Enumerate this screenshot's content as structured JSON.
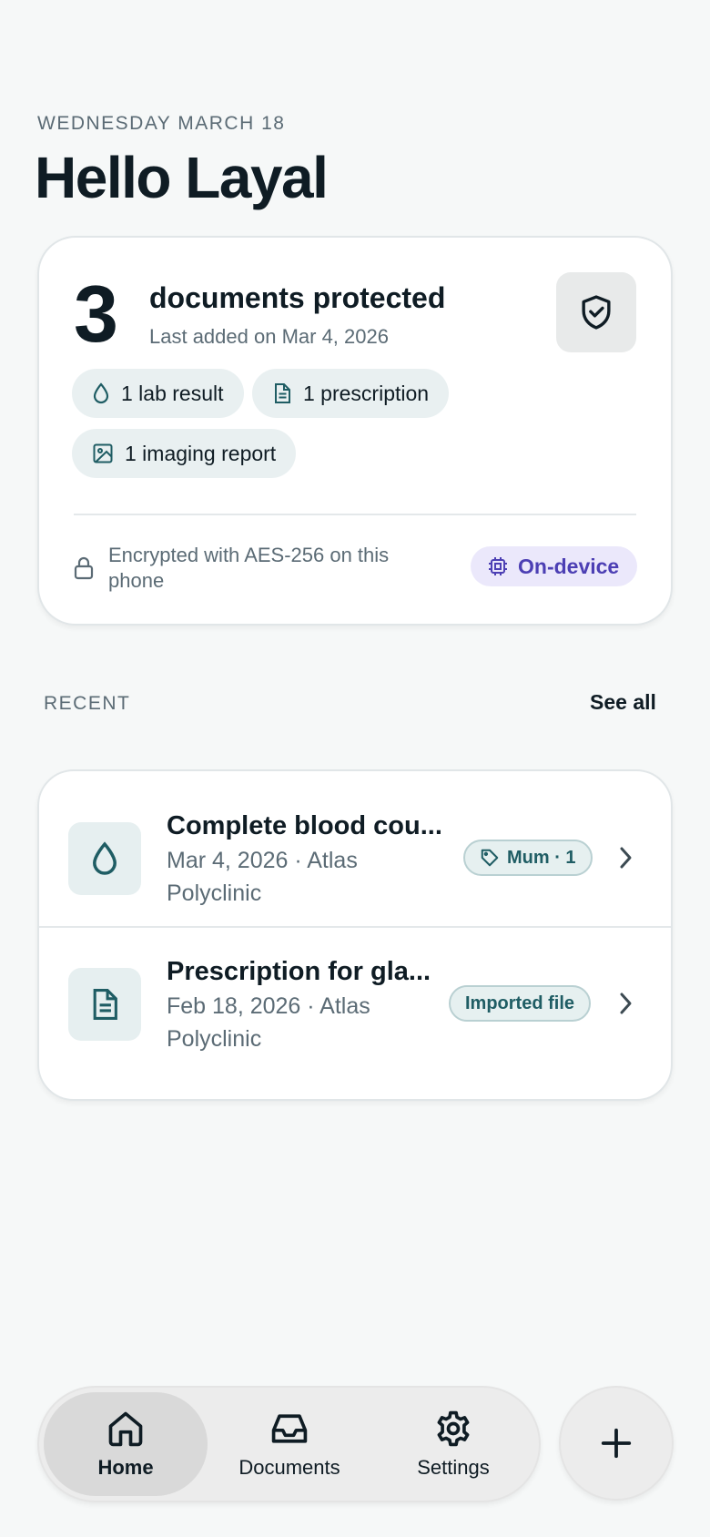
{
  "header": {
    "date": "WEDNESDAY MARCH 18",
    "greeting": "Hello Layal"
  },
  "summary": {
    "count": "3",
    "title": "documents protected",
    "subtitle": "Last added on Mar 4, 2026",
    "shield_icon": "shield-check-icon",
    "chips": [
      {
        "label": "1 lab result",
        "icon": "droplet-icon"
      },
      {
        "label": "1 prescription",
        "icon": "document-icon"
      },
      {
        "label": "1 imaging report",
        "icon": "image-icon"
      }
    ],
    "encryption_text": "Encrypted with AES-256 on this phone",
    "ondevice_label": "On-device"
  },
  "recent": {
    "label": "RECENT",
    "see_all": "See all",
    "items": [
      {
        "title": "Complete blood cou...",
        "meta": "Mar 4, 2026 · Atlas Polyclinic",
        "tag": "Mum · 1",
        "icon": "droplet-icon"
      },
      {
        "title": "Prescription for gla...",
        "meta": "Feb 18, 2026 · Atlas Polyclinic",
        "tag": "Imported file",
        "icon": "document-icon"
      }
    ]
  },
  "nav": {
    "items": [
      {
        "label": "Home",
        "icon": "home-icon",
        "active": true
      },
      {
        "label": "Documents",
        "icon": "inbox-icon",
        "active": false
      },
      {
        "label": "Settings",
        "icon": "gear-icon",
        "active": false
      }
    ],
    "add_icon": "plus-icon"
  },
  "colors": {
    "background": "#f6f8f8",
    "teal_accent": "#1f5d64",
    "purple_accent": "#4c3fb4",
    "text_primary": "#0f1c24",
    "text_secondary": "#5b6b75"
  }
}
